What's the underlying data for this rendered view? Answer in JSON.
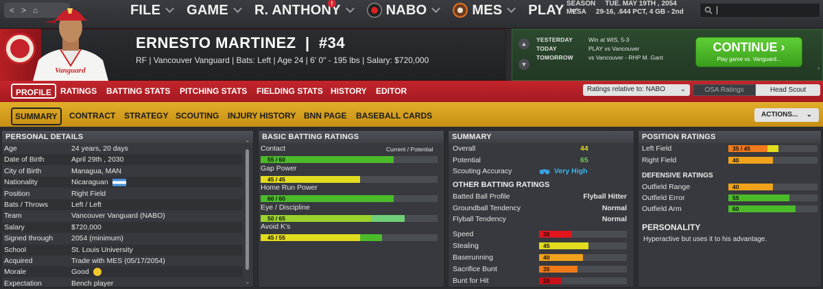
{
  "nav": {
    "back": "<",
    "forward": ">",
    "home": "⌂"
  },
  "menus": [
    {
      "label": "FILE"
    },
    {
      "label": "GAME"
    },
    {
      "label": "R. ANTHONY",
      "badge": "!"
    },
    {
      "label": "NABO"
    },
    {
      "label": "MES"
    },
    {
      "label": "PLAY"
    }
  ],
  "season": {
    "label": "SEASON",
    "date": "TUE. MAY 19TH , 2054",
    "team": "MESA",
    "record": "29-16, .644 PCT, 4 GB - 2nd"
  },
  "player": {
    "name": "ERNESTO MARTINEZ",
    "separator": "|",
    "number": "#34",
    "info": "RF | Vancouver Vanguard | Bats: Left | Age 24 | 6' 0\" - 195 lbs | Salary: $720,000",
    "jersey": "Vanguard"
  },
  "schedule": {
    "rows": [
      {
        "label": "YESTERDAY",
        "value": "Win at WIS, 5-3"
      },
      {
        "label": "TODAY",
        "value": "PLAY vs Vancouver"
      },
      {
        "label": "TOMORROW",
        "value": "vs Vancouver - RHP M. Gant"
      }
    ],
    "continue_label": "CONTINUE",
    "continue_sub": "Play game vs. Vanguard..."
  },
  "tabs_primary": [
    "PROFILE",
    "RATINGS",
    "BATTING STATS",
    "PITCHING STATS",
    "FIELDING STATS",
    "HISTORY",
    "EDITOR"
  ],
  "ratings_relative": "Ratings relative to: NABO",
  "osa_label": "OSA Ratings",
  "scout_label": "Head Scout",
  "tabs_secondary": [
    "SUMMARY",
    "CONTRACT",
    "STRATEGY",
    "SCOUTING",
    "INJURY HISTORY",
    "BNN PAGE",
    "BASEBALL CARDS"
  ],
  "actions_label": "ACTIONS...",
  "personal": {
    "title": "PERSONAL DETAILS",
    "rows": [
      {
        "k": "Age",
        "v": "24 years, 20 days"
      },
      {
        "k": "Date of Birth",
        "v": "April 29th , 2030"
      },
      {
        "k": "City of Birth",
        "v": "Managua, MAN"
      },
      {
        "k": "Nationality",
        "v": "Nicaraguan"
      },
      {
        "k": "Position",
        "v": "Right Field"
      },
      {
        "k": "Bats / Throws",
        "v": "Left / Left"
      },
      {
        "k": "Team",
        "v": "Vancouver Vanguard (NABO)"
      },
      {
        "k": "Salary",
        "v": "$720,000"
      },
      {
        "k": "Signed through",
        "v": "2054 (minimum)"
      },
      {
        "k": "School",
        "v": "St. Louis University"
      },
      {
        "k": "Acquired",
        "v": "Trade with MES (05/17/2054)"
      },
      {
        "k": "Morale",
        "v": "Good"
      },
      {
        "k": "Expectation",
        "v": "Bench player"
      }
    ]
  },
  "batting": {
    "title": "BASIC BATTING RATINGS",
    "legend": "Current / Potential",
    "rows": [
      {
        "label": "Contact",
        "text": "55 / 60",
        "cur": 55,
        "pot": 60,
        "cur_color": "#4cbb2a",
        "pot_color": "#4cbb2a"
      },
      {
        "label": "Gap Power",
        "text": "45 / 45",
        "cur": 45,
        "pot": 45,
        "cur_color": "#e3dc1e",
        "pot_color": "#e3dc1e"
      },
      {
        "label": "Home Run Power",
        "text": "60 / 60",
        "cur": 60,
        "pot": 60,
        "cur_color": "#4cbb2a",
        "pot_color": "#4cbb2a"
      },
      {
        "label": "Eye / Discipline",
        "text": "50 / 65",
        "cur": 50,
        "pot": 65,
        "cur_color": "#9bd22e",
        "pot_color": "#6fd079"
      },
      {
        "label": "Avoid K's",
        "text": "45 / 55",
        "cur": 45,
        "pot": 55,
        "cur_color": "#e3dc1e",
        "pot_color": "#4cbb2a"
      }
    ]
  },
  "summary": {
    "title": "SUMMARY",
    "rows": [
      {
        "k": "Overall",
        "v": "44"
      },
      {
        "k": "Potential",
        "v": "65"
      },
      {
        "k": "Scouting Accuracy",
        "v": "Very High"
      }
    ],
    "other_title": "OTHER BATTING RATINGS",
    "other": [
      {
        "k": "Batted Ball Profile",
        "v": "Flyball Hitter"
      },
      {
        "k": "Groundball Tendency",
        "v": "Normal"
      },
      {
        "k": "Flyball Tendency",
        "v": "Normal"
      }
    ],
    "speed": [
      {
        "k": "Speed",
        "v": "30",
        "n": 30,
        "color": "#e0161c"
      },
      {
        "k": "Stealing",
        "v": "45",
        "n": 45,
        "color": "#e3dc1e"
      },
      {
        "k": "Baserunning",
        "v": "40",
        "n": 40,
        "color": "#f0a21a"
      },
      {
        "k": "Sacrifice Bunt",
        "v": "35",
        "n": 35,
        "color": "#f07a1a"
      },
      {
        "k": "Bunt for Hit",
        "v": "20",
        "n": 20,
        "color": "#c8121a"
      }
    ]
  },
  "position": {
    "title": "POSITION RATINGS",
    "rows": [
      {
        "k": "Left Field",
        "v": "35 / 45",
        "n": 35,
        "p": 45,
        "color": "#f07a1a",
        "pcolor": "#e3dc1e"
      },
      {
        "k": "Right Field",
        "v": "40",
        "n": 40,
        "p": 40,
        "color": "#f0a21a",
        "pcolor": "#f0a21a"
      }
    ],
    "def_title": "DEFENSIVE RATINGS",
    "def": [
      {
        "k": "Outfield Range",
        "v": "40",
        "n": 40,
        "color": "#f0a21a"
      },
      {
        "k": "Outfield Error",
        "v": "55",
        "n": 55,
        "color": "#4cbb2a"
      },
      {
        "k": "Outfield Arm",
        "v": "60",
        "n": 60,
        "color": "#4cbb2a"
      }
    ],
    "pers_title": "PERSONALITY",
    "personality": "Hyperactive but uses it to his advantage."
  }
}
